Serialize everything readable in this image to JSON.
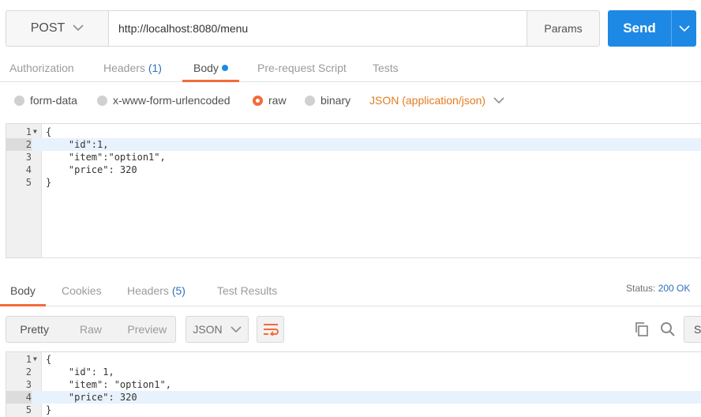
{
  "request": {
    "method": "POST",
    "url": "http://localhost:8080/menu",
    "params_label": "Params",
    "send_label": "Send"
  },
  "request_tabs": {
    "authorization": "Authorization",
    "headers": "Headers",
    "headers_count": "(1)",
    "body": "Body",
    "prerequest": "Pre-request Script",
    "tests": "Tests"
  },
  "body_types": {
    "form_data": "form-data",
    "urlencoded": "x-www-form-urlencoded",
    "raw": "raw",
    "binary": "binary",
    "content_type": "JSON (application/json)",
    "selected": "raw"
  },
  "request_editor": {
    "lines": [
      {
        "num": "1",
        "text": "{"
      },
      {
        "num": "2",
        "text": "    \"id\":1,"
      },
      {
        "num": "3",
        "text": "    \"item\":\"option1\","
      },
      {
        "num": "4",
        "text": "    \"price\": 320"
      },
      {
        "num": "5",
        "text": "}"
      }
    ]
  },
  "response_tabs": {
    "body": "Body",
    "cookies": "Cookies",
    "headers": "Headers",
    "headers_count": "(5)",
    "test_results": "Test Results",
    "status_label": "Status:",
    "status_value": "200 OK"
  },
  "response_toolbar": {
    "pretty": "Pretty",
    "raw": "Raw",
    "preview": "Preview",
    "format": "JSON",
    "save": "Save"
  },
  "response_editor": {
    "lines": [
      {
        "num": "1",
        "text": "{"
      },
      {
        "num": "2",
        "text": "    \"id\": 1,"
      },
      {
        "num": "3",
        "text": "    \"item\": \"option1\","
      },
      {
        "num": "4",
        "text": "    \"price\": 320"
      },
      {
        "num": "5",
        "text": "}"
      }
    ]
  },
  "colors": {
    "accent_orange": "#f26b3a",
    "send_blue": "#1e88e5",
    "link_blue": "#2f6fbf"
  }
}
